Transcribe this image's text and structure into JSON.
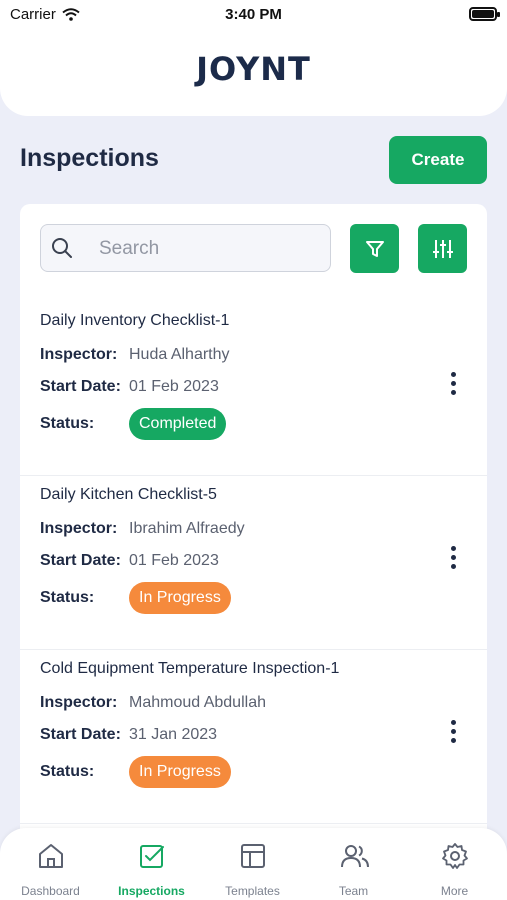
{
  "status_bar": {
    "carrier": "Carrier",
    "time": "3:40 PM"
  },
  "app": {
    "logo": "JOYNT"
  },
  "page": {
    "title": "Inspections",
    "create_label": "Create"
  },
  "search": {
    "placeholder": "Search"
  },
  "inspections": [
    {
      "title": "Daily Inventory Checklist-1",
      "inspector_label": "Inspector:",
      "inspector": "Huda Alharthy",
      "start_label": "Start Date:",
      "start_date": "01 Feb 2023",
      "status_label": "Status:",
      "status": "Completed",
      "status_color": "#16a862"
    },
    {
      "title": "Daily Kitchen Checklist-5",
      "inspector_label": "Inspector:",
      "inspector": "Ibrahim Alfraedy",
      "start_label": "Start Date:",
      "start_date": "01 Feb 2023",
      "status_label": "Status:",
      "status": "In Progress",
      "status_color": "#f58a3c"
    },
    {
      "title": "Cold Equipment Temperature Inspection-1",
      "inspector_label": "Inspector:",
      "inspector": "Mahmoud Abdullah",
      "start_label": "Start Date:",
      "start_date": "31 Jan 2023",
      "status_label": "Status:",
      "status": "In Progress",
      "status_color": "#f58a3c"
    }
  ],
  "tabs": [
    {
      "label": "Dashboard",
      "icon": "home-icon",
      "active": false
    },
    {
      "label": "Inspections",
      "icon": "checkbox-icon",
      "active": true
    },
    {
      "label": "Templates",
      "icon": "layout-icon",
      "active": false
    },
    {
      "label": "Team",
      "icon": "users-icon",
      "active": false
    },
    {
      "label": "More",
      "icon": "gear-icon",
      "active": false
    }
  ],
  "colors": {
    "accent": "#16a862",
    "in_progress": "#f58a3c",
    "text_dark": "#1f2a44",
    "background": "#eceef8"
  }
}
